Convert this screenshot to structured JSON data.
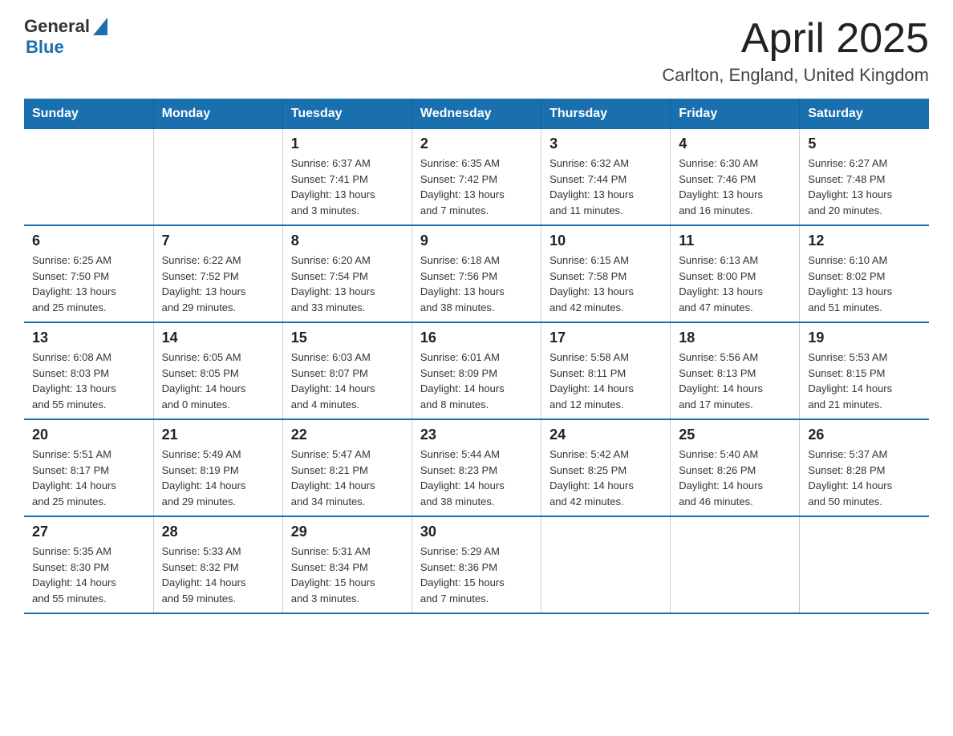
{
  "header": {
    "logo_general": "General",
    "logo_blue": "Blue",
    "title": "April 2025",
    "subtitle": "Carlton, England, United Kingdom"
  },
  "days_of_week": [
    "Sunday",
    "Monday",
    "Tuesday",
    "Wednesday",
    "Thursday",
    "Friday",
    "Saturday"
  ],
  "weeks": [
    [
      {
        "day": "",
        "info": ""
      },
      {
        "day": "",
        "info": ""
      },
      {
        "day": "1",
        "info": "Sunrise: 6:37 AM\nSunset: 7:41 PM\nDaylight: 13 hours\nand 3 minutes."
      },
      {
        "day": "2",
        "info": "Sunrise: 6:35 AM\nSunset: 7:42 PM\nDaylight: 13 hours\nand 7 minutes."
      },
      {
        "day": "3",
        "info": "Sunrise: 6:32 AM\nSunset: 7:44 PM\nDaylight: 13 hours\nand 11 minutes."
      },
      {
        "day": "4",
        "info": "Sunrise: 6:30 AM\nSunset: 7:46 PM\nDaylight: 13 hours\nand 16 minutes."
      },
      {
        "day": "5",
        "info": "Sunrise: 6:27 AM\nSunset: 7:48 PM\nDaylight: 13 hours\nand 20 minutes."
      }
    ],
    [
      {
        "day": "6",
        "info": "Sunrise: 6:25 AM\nSunset: 7:50 PM\nDaylight: 13 hours\nand 25 minutes."
      },
      {
        "day": "7",
        "info": "Sunrise: 6:22 AM\nSunset: 7:52 PM\nDaylight: 13 hours\nand 29 minutes."
      },
      {
        "day": "8",
        "info": "Sunrise: 6:20 AM\nSunset: 7:54 PM\nDaylight: 13 hours\nand 33 minutes."
      },
      {
        "day": "9",
        "info": "Sunrise: 6:18 AM\nSunset: 7:56 PM\nDaylight: 13 hours\nand 38 minutes."
      },
      {
        "day": "10",
        "info": "Sunrise: 6:15 AM\nSunset: 7:58 PM\nDaylight: 13 hours\nand 42 minutes."
      },
      {
        "day": "11",
        "info": "Sunrise: 6:13 AM\nSunset: 8:00 PM\nDaylight: 13 hours\nand 47 minutes."
      },
      {
        "day": "12",
        "info": "Sunrise: 6:10 AM\nSunset: 8:02 PM\nDaylight: 13 hours\nand 51 minutes."
      }
    ],
    [
      {
        "day": "13",
        "info": "Sunrise: 6:08 AM\nSunset: 8:03 PM\nDaylight: 13 hours\nand 55 minutes."
      },
      {
        "day": "14",
        "info": "Sunrise: 6:05 AM\nSunset: 8:05 PM\nDaylight: 14 hours\nand 0 minutes."
      },
      {
        "day": "15",
        "info": "Sunrise: 6:03 AM\nSunset: 8:07 PM\nDaylight: 14 hours\nand 4 minutes."
      },
      {
        "day": "16",
        "info": "Sunrise: 6:01 AM\nSunset: 8:09 PM\nDaylight: 14 hours\nand 8 minutes."
      },
      {
        "day": "17",
        "info": "Sunrise: 5:58 AM\nSunset: 8:11 PM\nDaylight: 14 hours\nand 12 minutes."
      },
      {
        "day": "18",
        "info": "Sunrise: 5:56 AM\nSunset: 8:13 PM\nDaylight: 14 hours\nand 17 minutes."
      },
      {
        "day": "19",
        "info": "Sunrise: 5:53 AM\nSunset: 8:15 PM\nDaylight: 14 hours\nand 21 minutes."
      }
    ],
    [
      {
        "day": "20",
        "info": "Sunrise: 5:51 AM\nSunset: 8:17 PM\nDaylight: 14 hours\nand 25 minutes."
      },
      {
        "day": "21",
        "info": "Sunrise: 5:49 AM\nSunset: 8:19 PM\nDaylight: 14 hours\nand 29 minutes."
      },
      {
        "day": "22",
        "info": "Sunrise: 5:47 AM\nSunset: 8:21 PM\nDaylight: 14 hours\nand 34 minutes."
      },
      {
        "day": "23",
        "info": "Sunrise: 5:44 AM\nSunset: 8:23 PM\nDaylight: 14 hours\nand 38 minutes."
      },
      {
        "day": "24",
        "info": "Sunrise: 5:42 AM\nSunset: 8:25 PM\nDaylight: 14 hours\nand 42 minutes."
      },
      {
        "day": "25",
        "info": "Sunrise: 5:40 AM\nSunset: 8:26 PM\nDaylight: 14 hours\nand 46 minutes."
      },
      {
        "day": "26",
        "info": "Sunrise: 5:37 AM\nSunset: 8:28 PM\nDaylight: 14 hours\nand 50 minutes."
      }
    ],
    [
      {
        "day": "27",
        "info": "Sunrise: 5:35 AM\nSunset: 8:30 PM\nDaylight: 14 hours\nand 55 minutes."
      },
      {
        "day": "28",
        "info": "Sunrise: 5:33 AM\nSunset: 8:32 PM\nDaylight: 14 hours\nand 59 minutes."
      },
      {
        "day": "29",
        "info": "Sunrise: 5:31 AM\nSunset: 8:34 PM\nDaylight: 15 hours\nand 3 minutes."
      },
      {
        "day": "30",
        "info": "Sunrise: 5:29 AM\nSunset: 8:36 PM\nDaylight: 15 hours\nand 7 minutes."
      },
      {
        "day": "",
        "info": ""
      },
      {
        "day": "",
        "info": ""
      },
      {
        "day": "",
        "info": ""
      }
    ]
  ]
}
